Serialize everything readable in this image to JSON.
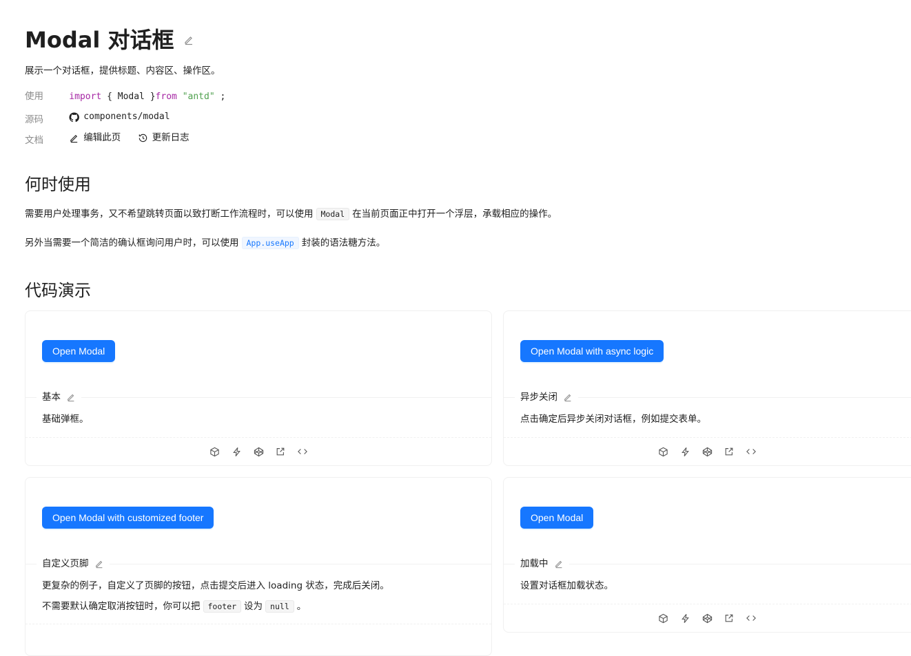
{
  "page": {
    "title": "Modal 对话框",
    "subtitle": "展示一个对话框，提供标题、内容区、操作区。"
  },
  "meta": {
    "usage_label": "使用",
    "usage_import": "import",
    "usage_open": "{",
    "usage_component": "Modal",
    "usage_close": "}",
    "usage_from": "from",
    "usage_source": "\"antd\"",
    "usage_semicolon": ";",
    "source_label": "源码",
    "source_path": "components/modal",
    "docs_label": "文档",
    "edit_page": "编辑此页",
    "changelog": "更新日志"
  },
  "when_to_use": {
    "heading": "何时使用",
    "p1_before": "需要用户处理事务，又不希望跳转页面以致打断工作流程时，可以使用",
    "p1_code": "Modal",
    "p1_after": "在当前页面正中打开一个浮层，承载相应的操作。",
    "p2_before": "另外当需要一个简洁的确认框询问用户时，可以使用",
    "p2_code": "App.useApp",
    "p2_after": "封装的语法糖方法。"
  },
  "demos_heading": "代码演示",
  "demos": [
    {
      "button": "Open Modal",
      "title": "基本",
      "desc": "基础弹框。"
    },
    {
      "button": "Open Modal with async logic",
      "title": "异步关闭",
      "desc": "点击确定后异步关闭对话框，例如提交表单。"
    },
    {
      "button": "Open Modal with customized footer",
      "title": "自定义页脚",
      "desc": "更复杂的例子，自定义了页脚的按钮，点击提交后进入 loading 状态，完成后关闭。",
      "desc2_before": "不需要默认确定取消按钮时，你可以把",
      "desc2_code1": "footer",
      "desc2_mid": "设为",
      "desc2_code2": "null",
      "desc2_after": "。"
    },
    {
      "button": "Open Modal",
      "title": "加载中",
      "desc": "设置对话框加载状态。"
    }
  ],
  "icons": {
    "edit": "edit-icon",
    "github": "github-icon",
    "history": "history-icon",
    "codesandbox": "codesandbox-icon",
    "stackblitz": "thunderbolt-icon",
    "codepen": "codepen-icon",
    "external": "external-link-icon",
    "code": "code-icon"
  },
  "colors": {
    "primary": "#1677ff",
    "keyword": "#a626a4",
    "string": "#50a14f"
  }
}
